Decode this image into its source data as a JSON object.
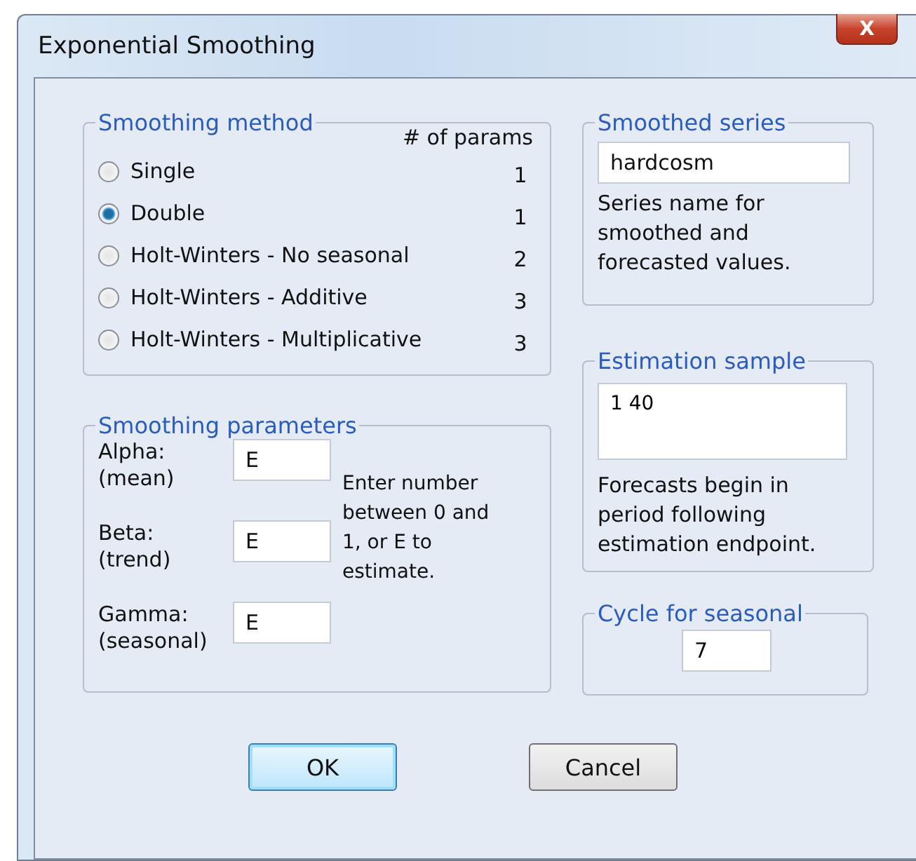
{
  "window": {
    "title": "Exponential Smoothing",
    "close": "X"
  },
  "smoothing_method": {
    "legend": "Smoothing method",
    "params_heading": "# of params",
    "options": [
      {
        "label": "Single",
        "params": "1",
        "selected": false
      },
      {
        "label": "Double",
        "params": "1",
        "selected": true
      },
      {
        "label": "Holt-Winters - No seasonal",
        "params": "2",
        "selected": false
      },
      {
        "label": "Holt-Winters - Additive",
        "params": "3",
        "selected": false
      },
      {
        "label": "Holt-Winters - Multiplicative",
        "params": "3",
        "selected": false
      }
    ]
  },
  "smoothing_parameters": {
    "legend": "Smoothing parameters",
    "fields": [
      {
        "label": "Alpha:",
        "sublabel": "(mean)",
        "value": "E"
      },
      {
        "label": "Beta:",
        "sublabel": "(trend)",
        "value": "E"
      },
      {
        "label": "Gamma:",
        "sublabel": "(seasonal)",
        "value": "E"
      }
    ],
    "hint": "Enter number between  0 and 1, or E to estimate."
  },
  "smoothed_series": {
    "legend": "Smoothed series",
    "value": "hardcosm",
    "hint": "Series name for smoothed and forecasted values."
  },
  "estimation_sample": {
    "legend": "Estimation sample",
    "value": "1 40",
    "hint": "Forecasts begin in period following estimation endpoint."
  },
  "cycle_for_seasonal": {
    "legend": "Cycle for seasonal",
    "value": "7"
  },
  "buttons": [
    {
      "label": "OK",
      "default": true
    },
    {
      "label": "Cancel",
      "default": false
    }
  ]
}
